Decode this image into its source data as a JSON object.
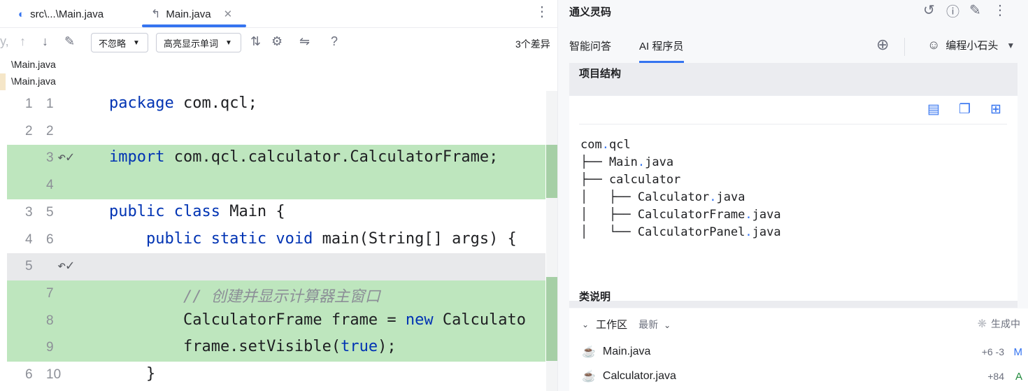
{
  "editor": {
    "tabs": [
      {
        "label": "src\\...\\Main.java",
        "icon": "diff-icon",
        "active": false
      },
      {
        "label": "Main.java",
        "icon": "diff-arrow-icon",
        "active": true
      }
    ],
    "toolbar": {
      "ignore_label": "不忽略",
      "highlight_label": "高亮显示单词",
      "diff_count": "3个差异",
      "help": "?"
    },
    "paths": [
      "\\Main.java",
      "\\Main.java"
    ],
    "lines": [
      {
        "l": "1",
        "r": "1",
        "code": [
          {
            "t": "package",
            "k": "kw"
          },
          {
            "t": " com.qcl;",
            "k": ""
          }
        ]
      },
      {
        "l": "2",
        "r": "2",
        "code": []
      },
      {
        "l": "",
        "r": "3",
        "code": [
          {
            "t": "import",
            "k": "kw"
          },
          {
            "t": " com.qcl.calculator.CalculatorFrame;",
            "k": ""
          }
        ]
      },
      {
        "l": "",
        "r": "4",
        "code": []
      },
      {
        "l": "3",
        "r": "5",
        "code": [
          {
            "t": "public class",
            "k": "kw"
          },
          {
            "t": " Main {",
            "k": ""
          }
        ]
      },
      {
        "l": "4",
        "r": "6",
        "code": [
          {
            "t": "    public static void",
            "k": "kw"
          },
          {
            "t": " main(String[] args) {",
            "k": ""
          }
        ]
      },
      {
        "l": "5",
        "r": "",
        "code": []
      },
      {
        "l": "",
        "r": "7",
        "code": [
          {
            "t": "        // 创建并显示计算器主窗口",
            "k": "cm"
          }
        ]
      },
      {
        "l": "",
        "r": "8",
        "code": [
          {
            "t": "        CalculatorFrame frame = ",
            "k": ""
          },
          {
            "t": "new",
            "k": "kw"
          },
          {
            "t": " Calculato",
            "k": ""
          }
        ]
      },
      {
        "l": "",
        "r": "9",
        "code": [
          {
            "t": "        frame.setVisible(",
            "k": ""
          },
          {
            "t": "true",
            "k": "kw"
          },
          {
            "t": ");",
            "k": ""
          }
        ]
      },
      {
        "l": "6",
        "r": "10",
        "code": [
          {
            "t": "    }",
            "k": ""
          }
        ]
      }
    ]
  },
  "assistant": {
    "title": "通义灵码",
    "tabs": [
      "智能问答",
      "AI 程序员"
    ],
    "user": "编程小石头",
    "project_heading": "项目结构",
    "tree_lines": [
      [
        "com",
        ".",
        "qcl"
      ],
      [
        "├── Main",
        ".",
        "java"
      ],
      [
        "├── calculator"
      ],
      [
        "│   ├── Calculator",
        ".",
        "java"
      ],
      [
        "│   ├── CalculatorFrame",
        ".",
        "java"
      ],
      [
        "│   └── CalculatorPanel",
        ".",
        "java"
      ]
    ],
    "class_heading": "类说明",
    "workspace": {
      "label": "工作区",
      "sort": "最新",
      "status": "生成中",
      "files": [
        {
          "name": "Main.java",
          "delta": "+6 -3",
          "status": "M"
        },
        {
          "name": "Calculator.java",
          "delta": "+84",
          "status": "A"
        }
      ]
    },
    "colors": {
      "accent": "#3574f0",
      "inserted": "#bee6be",
      "added": "#208a3c"
    }
  }
}
